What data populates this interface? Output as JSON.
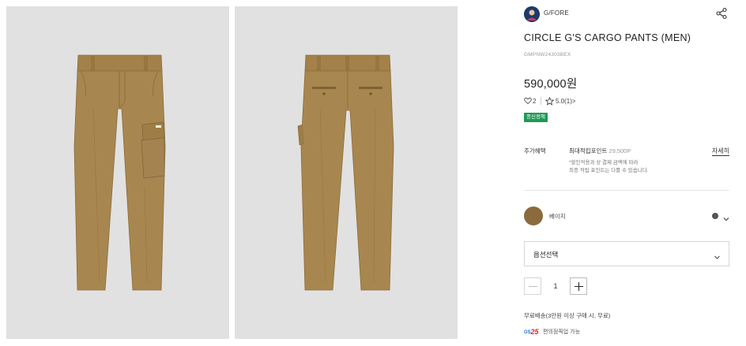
{
  "gallery": {
    "images": [
      {
        "alt": "front view"
      },
      {
        "alt": "back view"
      }
    ]
  },
  "product": {
    "brand": "G/FORE",
    "title": "CIRCLE G'S CARGO PANTS (MEN)",
    "code": "GMPNW24303BEX",
    "price": "590,000원",
    "likes": "2",
    "rating": "5.0(1)>",
    "badge": "종신정책"
  },
  "benefits": {
    "label": "추가혜택",
    "max_points_label": "최대적립포인트",
    "max_points_value": "29,500P",
    "note_line1": "*할인적용과 상 결제 금액에 따라",
    "note_line2": "최종 적립 포인트는 다를 수 있습니다.",
    "detail_link": "자세히"
  },
  "color_option": {
    "name": "베이지",
    "swatch_color": "#8b6a3c",
    "dot_color": "#555555"
  },
  "option_select": {
    "label": "옵션선택"
  },
  "quantity": {
    "value": "1"
  },
  "delivery": {
    "shipping": "무료배송(3만원 이상 구매 시, 무료)",
    "pickup": "편의점픽업 가능"
  },
  "icons": {
    "share": "share-icon",
    "heart": "heart-icon",
    "star": "star-icon",
    "chevron": "chevron-down-icon",
    "gs25": "gs25-logo"
  },
  "colors": {
    "badge_green": "#1e9a54",
    "pants_khaki": "#a8864f",
    "photo_bg": "#e1e1e1"
  }
}
